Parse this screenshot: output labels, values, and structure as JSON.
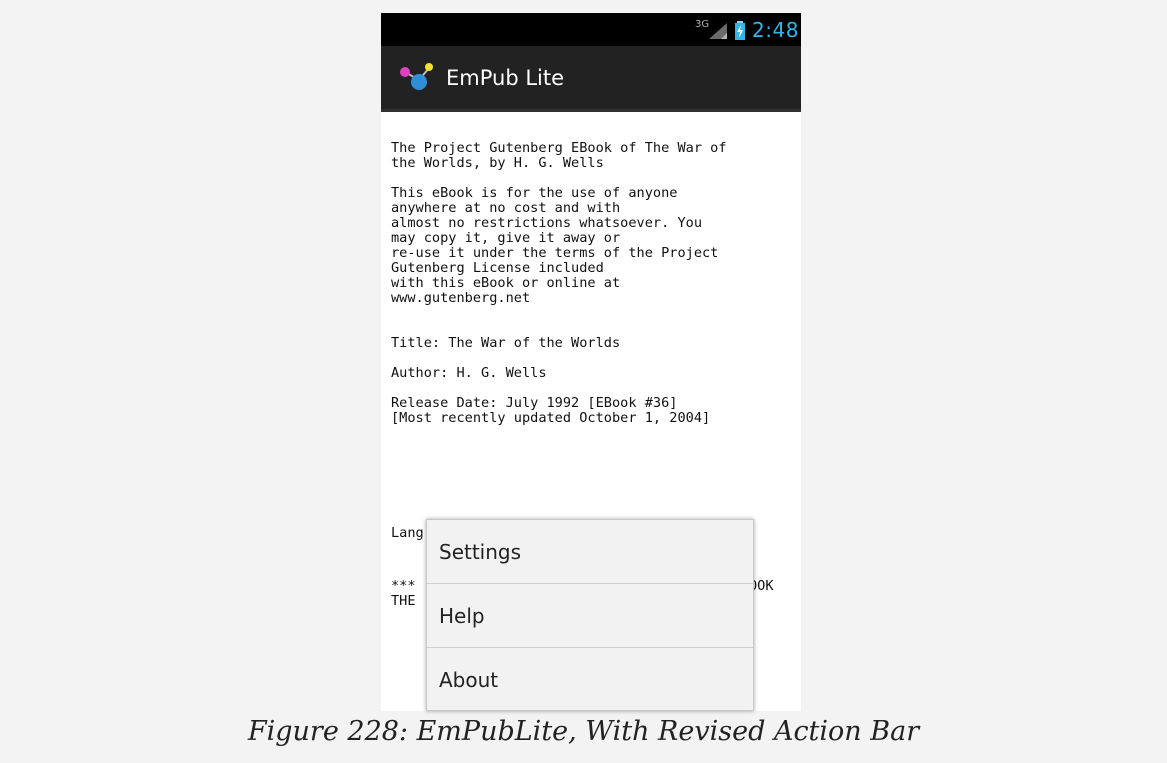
{
  "status_bar": {
    "network_label": "3G",
    "time": "2:48",
    "icons": [
      "signal-icon",
      "battery-charging-icon"
    ],
    "time_color": "#33b5e5"
  },
  "action_bar": {
    "title": "EmPub Lite",
    "icon": "app-molecule-icon"
  },
  "book_text": {
    "intro": "The Project Gutenberg EBook of The War of\nthe Worlds, by H. G. Wells",
    "license": "This eBook is for the use of anyone\nanywhere at no cost and with\nalmost no restrictions whatsoever. You\nmay copy it, give it away or\nre-use it under the terms of the Project\nGutenberg License included\nwith this eBook or online at\nwww.gutenberg.net",
    "title_line": "Title: The War of the Worlds",
    "author_line": "Author: H. G. Wells",
    "release_line": "Release Date: July 1992 [EBook #36]\n[Most recently updated October 1, 2004]",
    "language_partial": "Lang",
    "stars_partial": "***",
    "the_partial": "THE",
    "ebook_partial": "OOK"
  },
  "overflow_menu": {
    "items": [
      {
        "label": "Settings"
      },
      {
        "label": "Help"
      },
      {
        "label": "About"
      }
    ]
  },
  "caption": "Figure 228: EmPubLite, With Revised Action Bar"
}
